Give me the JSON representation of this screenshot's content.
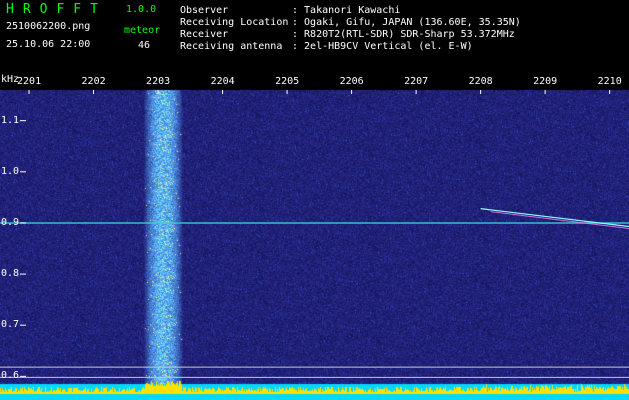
{
  "header": {
    "app_name": "HROFFT",
    "app_version": "1.0.0",
    "file_name": "2510062200.png",
    "timestamp": "25.10.06 22:00",
    "meteor_label": "meteor",
    "meteor_count": "46",
    "info": [
      {
        "label": "Observer",
        "value": ": Takanori Kawachi"
      },
      {
        "label": "Receiving Location",
        "value": ": Ogaki, Gifu, JAPAN (136.60E, 35.35N)"
      },
      {
        "label": "Receiver",
        "value": ": R820T2(RTL-SDR) SDR-Sharp 53.372MHz"
      },
      {
        "label": "Receiving antenna",
        "value": ": 2el-HB9CV Vertical (el. E-W)"
      }
    ]
  },
  "chart_data": {
    "type": "heatmap",
    "ylabel": "kHz",
    "x_ticks": [
      "2201",
      "2202",
      "2203",
      "2204",
      "2205",
      "2206",
      "2207",
      "2208",
      "2209",
      "2210"
    ],
    "y_ticks": [
      "1.1",
      "1.0",
      "0.9",
      "0.8",
      "0.7",
      "0.6"
    ],
    "ylim": [
      0.585,
      1.16
    ],
    "xlim": [
      2200.55,
      2210.3
    ],
    "signals": {
      "carrier_khz": 0.9,
      "noise_band_minutes": [
        2202.85,
        2203.3
      ],
      "meteor_trail": {
        "start_minute": 2208.0,
        "end_minute": 2210.3,
        "start_khz": 0.928,
        "end_khz": 0.893
      }
    },
    "colors": {
      "background": "#1d1f7a",
      "noise_band": "#3a8fd0",
      "carrier": "#3fcfcf",
      "baseline": "#00d8ff",
      "peaks": "#ffe000"
    }
  }
}
